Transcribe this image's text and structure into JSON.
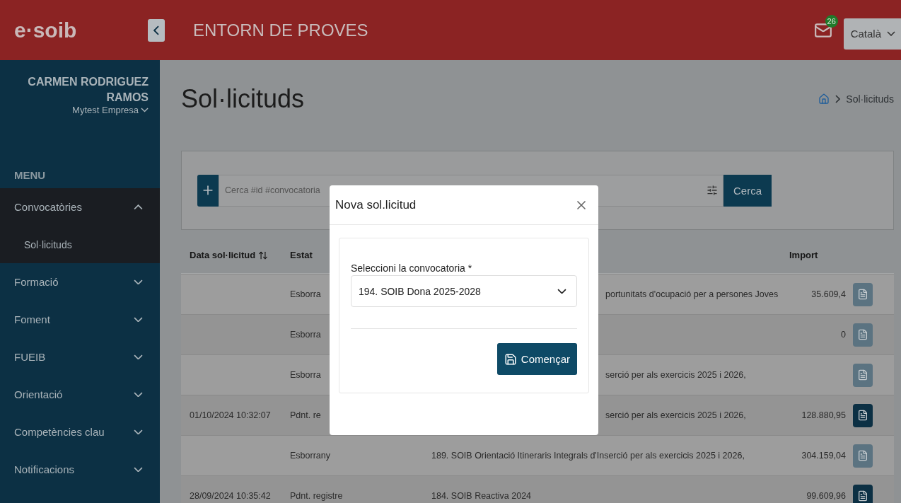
{
  "header": {
    "logo": "e·soib",
    "title": "ENTORN DE PROVES",
    "notifications": "26",
    "language": "Català"
  },
  "sidebar": {
    "user_name": "CARMEN RODRIGUEZ RAMOS",
    "company": "Mytest Empresa",
    "menu_label": "MENU",
    "items": [
      {
        "label": "Convocatòries",
        "expanded": true,
        "children": [
          {
            "label": "Sol·licituds",
            "selected": true
          }
        ]
      },
      {
        "label": "Formació",
        "expanded": false
      },
      {
        "label": "Foment",
        "expanded": false
      },
      {
        "label": "FUEIB",
        "expanded": false
      },
      {
        "label": "Orientació",
        "expanded": false
      },
      {
        "label": "Competències clau",
        "expanded": false
      },
      {
        "label": "Notificacions",
        "expanded": false
      }
    ]
  },
  "page": {
    "title": "Sol·licituds",
    "breadcrumb": [
      "Sol·licituds"
    ]
  },
  "search": {
    "placeholder": "Cerca #id #convocatoria",
    "button": "Cerca"
  },
  "table": {
    "columns": [
      {
        "label": "Data sol·licitud",
        "sortable": true
      },
      {
        "label": "Estat",
        "sortable": false
      },
      {
        "label": "Import",
        "sortable": false
      }
    ],
    "rows": [
      {
        "date": "",
        "status": "Esborra",
        "description": "portunitats d'ocupació per a persones Joves",
        "amount": "35.609,4",
        "covered": true,
        "pdf_active": false
      },
      {
        "date": "",
        "status": "Esborra",
        "description": "",
        "amount": "0",
        "pdf_active": false
      },
      {
        "date": "",
        "status": "Esborra",
        "description": "serció per als exercicis 2025 i 2026,",
        "amount": "",
        "covered": true,
        "pdf_active": false
      },
      {
        "date": "01/10/2024 10:32:07",
        "status": "Pdnt. re",
        "description": "serció per als exercicis 2025 i 2026,",
        "amount": "128.880,95",
        "covered": true,
        "pdf_active": true
      },
      {
        "date": "",
        "status": "Esborrany",
        "description": "189. SOIB Orientació Itineraris Integrals d'Inserció per als exercicis 2025 i 2026,",
        "amount": "304.159,04",
        "covered": false,
        "pdf_active": false
      },
      {
        "date": "28/09/2024 10:35:42",
        "status": "Pdnt. registre",
        "description": "184. SOIB Reactiva 2024",
        "amount": "99.609,96",
        "covered": false,
        "pdf_active": true
      }
    ]
  },
  "modal": {
    "title": "Nova sol.licitud",
    "field_label": "Seleccioni la convocatoria *",
    "select_value": "194. SOIB Dona 2025-2028",
    "button": "Començar"
  }
}
